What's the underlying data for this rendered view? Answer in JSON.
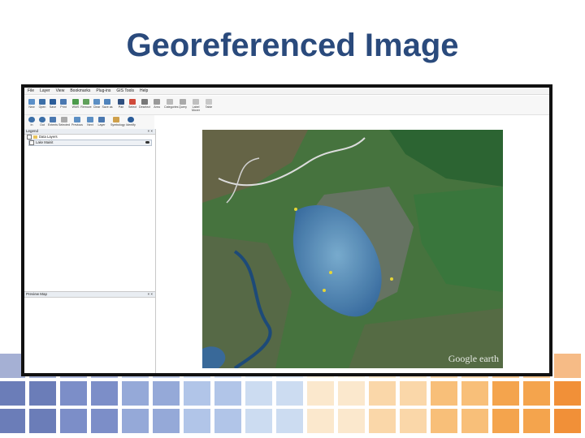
{
  "slide": {
    "title": "Georeferenced Image"
  },
  "app": {
    "menu": [
      "File",
      "Layer",
      "View",
      "Bookmarks",
      "Plug-ins",
      "GIS Tools",
      "Help"
    ],
    "toolbar_main": [
      {
        "label": "New",
        "icon": "new-icon"
      },
      {
        "label": "Open",
        "icon": "open-icon"
      },
      {
        "label": "Save",
        "icon": "save-icon"
      },
      {
        "label": "Print",
        "icon": "print-icon"
      },
      {
        "label": "WMS",
        "icon": "wms-icon"
      },
      {
        "label": "Remove",
        "icon": "remove-icon"
      },
      {
        "label": "Clear",
        "icon": "clear-icon"
      },
      {
        "label": "Save as",
        "icon": "save-as-icon"
      },
      {
        "label": "Pan",
        "icon": "pan-icon"
      },
      {
        "label": "Select",
        "icon": "select-icon"
      },
      {
        "label": "Deselect",
        "icon": "deselect-icon"
      },
      {
        "label": "Area",
        "icon": "area-icon"
      },
      {
        "label": "Categories",
        "icon": "categories-icon"
      },
      {
        "label": "Query",
        "icon": "query-icon"
      },
      {
        "label": "Label Mover",
        "icon": "label-mover-icon"
      },
      {
        "label": "Table",
        "icon": "table-icon"
      }
    ],
    "toolbar_second": [
      {
        "label": "In",
        "icon": "zoom-in-icon"
      },
      {
        "label": "Out",
        "icon": "zoom-out-icon"
      },
      {
        "label": "Extents",
        "icon": "extents-icon"
      },
      {
        "label": "Selected",
        "icon": "selected-icon"
      },
      {
        "label": "Previous",
        "icon": "previous-icon"
      },
      {
        "label": "Next",
        "icon": "next-icon"
      },
      {
        "label": "Layer",
        "icon": "layer-icon"
      },
      {
        "label": "Symbology",
        "icon": "symbology-icon"
      },
      {
        "label": "Identify",
        "icon": "identify-icon"
      }
    ],
    "legend": {
      "title": "Legend",
      "group": "Data Layers",
      "layer": "Lake Mainit"
    },
    "preview": {
      "title": "Preview Map"
    },
    "map": {
      "watermark": "Google earth"
    }
  }
}
